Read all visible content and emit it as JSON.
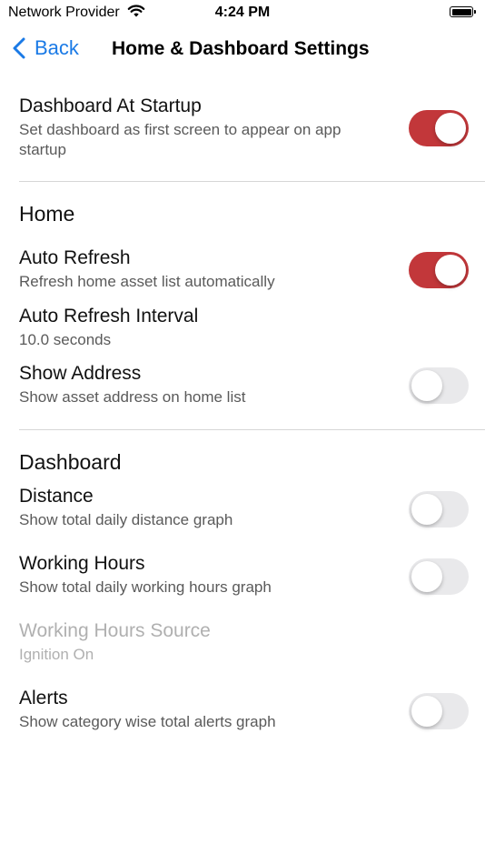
{
  "status_bar": {
    "carrier": "Network Provider",
    "time": "4:24 PM"
  },
  "nav": {
    "back_label": "Back",
    "title": "Home & Dashboard Settings"
  },
  "dashboard_at_startup": {
    "title": "Dashboard At Startup",
    "subtitle": "Set dashboard as first screen to appear on app startup",
    "enabled": true
  },
  "home": {
    "header": "Home",
    "auto_refresh": {
      "title": "Auto Refresh",
      "subtitle": "Refresh home asset list automatically",
      "enabled": true
    },
    "auto_refresh_interval": {
      "title": "Auto Refresh Interval",
      "value": "10.0 seconds"
    },
    "show_address": {
      "title": "Show Address",
      "subtitle": "Show asset address on home list",
      "enabled": false
    }
  },
  "dashboard": {
    "header": "Dashboard",
    "distance": {
      "title": "Distance",
      "subtitle": "Show total daily distance graph",
      "enabled": false
    },
    "working_hours": {
      "title": "Working Hours",
      "subtitle": "Show total daily working hours graph",
      "enabled": false
    },
    "working_hours_source": {
      "title": "Working Hours Source",
      "value": "Ignition On"
    },
    "alerts": {
      "title": "Alerts",
      "subtitle": "Show category wise total alerts graph",
      "enabled": false
    }
  },
  "colors": {
    "accent": "#1a7ae6",
    "toggle_on": "#c2373a",
    "toggle_off": "#e9e9eb"
  }
}
